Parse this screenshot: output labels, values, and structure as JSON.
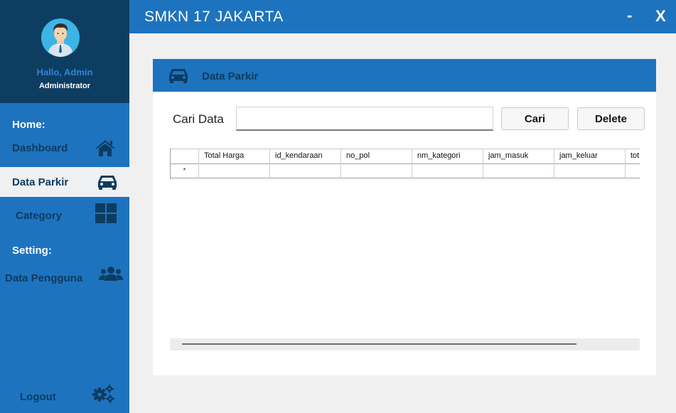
{
  "window": {
    "title": "SMKN 17 JAKARTA",
    "minimize_label": "-",
    "close_label": "X"
  },
  "profile": {
    "greeting": "Hallo, Admin",
    "role": "Administrator"
  },
  "sidebar": {
    "home_section": "Home:",
    "setting_section": "Setting:",
    "items": [
      {
        "label": "Dashboard",
        "icon": "home-icon"
      },
      {
        "label": "Data Parkir",
        "icon": "car-icon"
      },
      {
        "label": "Category",
        "icon": "grid-icon"
      },
      {
        "label": "Data Pengguna",
        "icon": "users-icon"
      }
    ],
    "logout_label": "Logout",
    "active_item": "Data Parkir"
  },
  "panel": {
    "title": "Data Parkir",
    "search_label": "Cari Data",
    "search_value": "",
    "cari_button": "Cari",
    "delete_button": "Delete"
  },
  "table": {
    "columns": [
      "Total Harga",
      "id_kendaraan",
      "no_pol",
      "nm_kategori",
      "jam_masuk",
      "jam_keluar",
      "total"
    ],
    "new_row_marker": "*"
  },
  "colors": {
    "primary_blue": "#1e73be",
    "dark_navy": "#0e3d62",
    "label_navy": "#0d3c61",
    "active_bg": "#eef0f2"
  }
}
